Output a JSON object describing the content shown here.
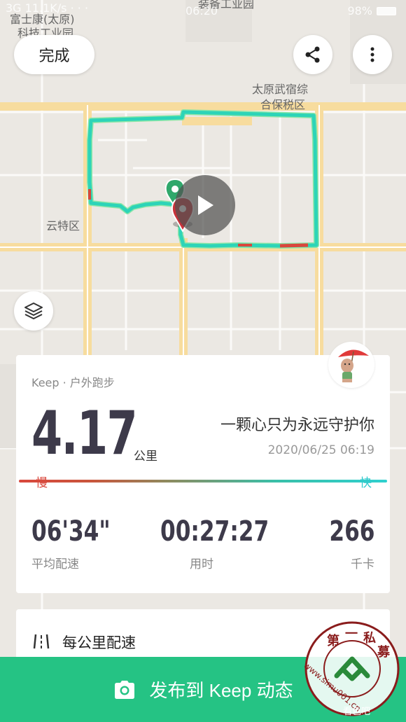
{
  "status_bar": {
    "network_speed": "3G 11.1K/s · · ·",
    "time": "06:20",
    "battery_percent": "98%"
  },
  "map": {
    "labels": {
      "top_left_line1": "富士康(太原)",
      "top_left_line2": "科技工业园",
      "top_center": "装备工业园",
      "zone_line1": "太原武宿综",
      "zone_line2": "合保税区",
      "west": "云特区"
    },
    "route_color": "#2dd4b8",
    "route_slow_color": "#d9473c",
    "start_marker_color": "#2fa86b",
    "end_marker_color": "#c9323a"
  },
  "controls": {
    "done_label": "完成",
    "share_icon": "share-icon",
    "more_icon": "more-vertical-icon",
    "layers_icon": "layers-icon",
    "play_icon": "play-icon"
  },
  "summary": {
    "sport_type": "Keep · 户外跑步",
    "distance": "4.17",
    "distance_unit": "公里",
    "motto": "一颗心只为永远守护你",
    "datetime": "2020/06/25 06:19",
    "speed_slow_label": "慢",
    "speed_fast_label": "快",
    "stats": [
      {
        "value": "06'34\"",
        "label": "平均配速"
      },
      {
        "value": "00:27:27",
        "label": "用时"
      },
      {
        "value": "266",
        "label": "千卡"
      }
    ]
  },
  "splits": {
    "title": "每公里配速"
  },
  "publish": {
    "label": "发布到 Keep 动态",
    "icon": "camera-icon",
    "color": "#25c384"
  },
  "watermark": {
    "stamp_text": "第一私募",
    "url_text": "www.simu001.cn",
    "overlay_text": "看色吧"
  }
}
